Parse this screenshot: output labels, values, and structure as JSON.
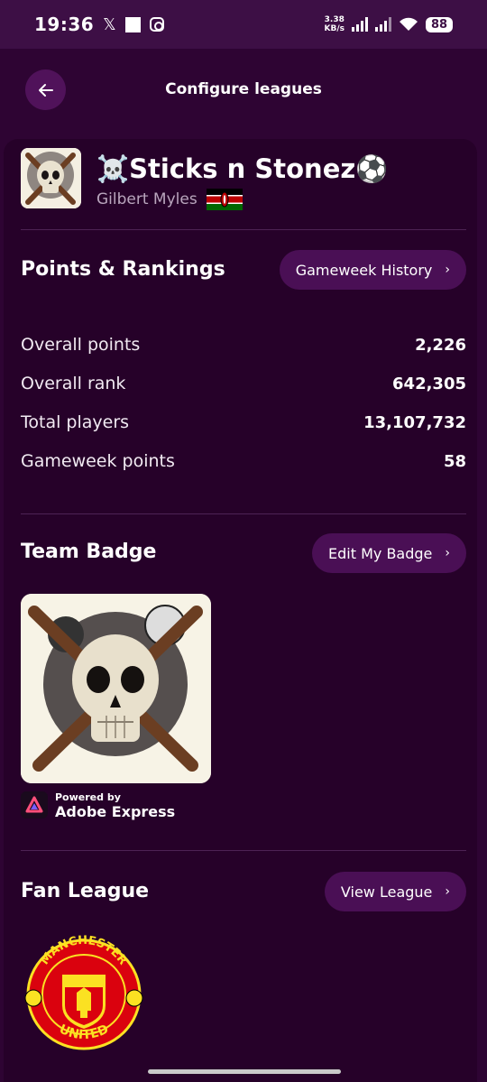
{
  "status_bar": {
    "time": "19:36",
    "net_speed_value": "3.38",
    "net_speed_unit": "KB/s",
    "battery": "88"
  },
  "top_bar": {
    "title": "Configure leagues"
  },
  "team": {
    "name": "☠️Sticks n Stonez⚽",
    "manager": "Gilbert Myles"
  },
  "points_rankings": {
    "title": "Points & Rankings",
    "history_button": "Gameweek History",
    "stats": [
      {
        "label": "Overall points",
        "value": "2,226"
      },
      {
        "label": "Overall rank",
        "value": "642,305"
      },
      {
        "label": "Total players",
        "value": "13,107,732"
      },
      {
        "label": "Gameweek points",
        "value": "58"
      }
    ]
  },
  "team_badge": {
    "title": "Team Badge",
    "edit_button": "Edit My Badge",
    "powered_by": "Powered by",
    "provider": "Adobe Express"
  },
  "fan_league": {
    "title": "Fan League",
    "view_button": "View League",
    "crest_top_text": "MANCHESTER",
    "crest_bottom_text": "UNITED"
  },
  "colors": {
    "background": "#2e0433",
    "card": "#260129",
    "button": "#4a0f55",
    "accent_red": "#da020e",
    "accent_gold": "#fbe122"
  }
}
